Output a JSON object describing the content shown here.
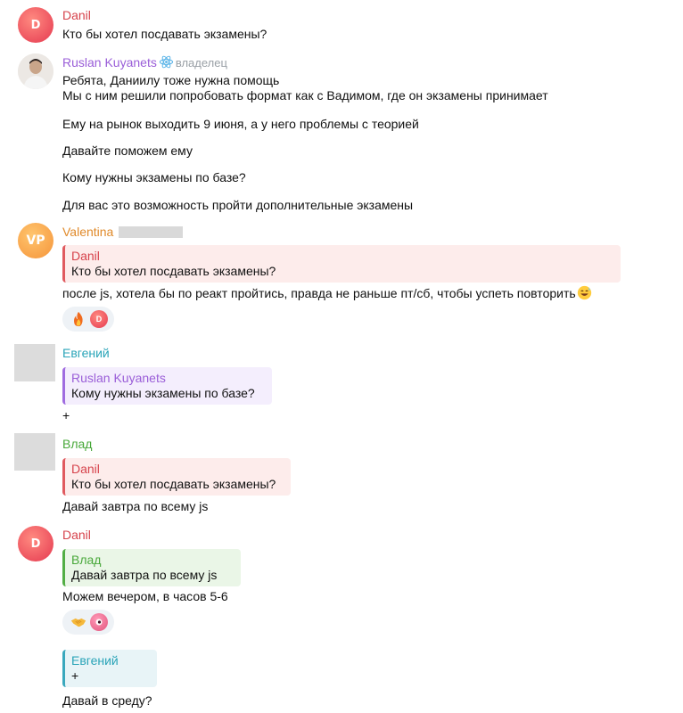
{
  "messages": {
    "m1": {
      "avatar": "D",
      "author": "Danil",
      "text": "Кто бы хотел посдавать экзамены?"
    },
    "m2": {
      "author": "Ruslan Kuyanets",
      "role": "владелец",
      "lines": [
        "Ребята, Даниилу тоже нужна помощь",
        "Мы с ним решили попробовать формат как с Вадимом, где он экзамены принимает",
        "Ему на рынок выходить 9 июня, а у него проблемы с теорией",
        "Давайте поможем ему",
        "Кому нужны экзамены по базе?",
        "Для вас это возможность пройти дополнительные экзамены"
      ]
    },
    "m3": {
      "avatar": "VP",
      "author": "Valentina",
      "quote_author": "Danil",
      "quote_text": "Кто бы хотел посдавать экзамены?",
      "text": "после js, хотела бы по реакт пройтись, правда не раньше пт/сб, чтобы успеть повторить",
      "reaction_avatar": "D"
    },
    "m4": {
      "author": "Евгений",
      "quote_author": "Ruslan Kuyanets",
      "quote_text": "Кому нужны экзамены по базе?",
      "text": "+"
    },
    "m5": {
      "author": "Влад",
      "quote_author": "Danil",
      "quote_text": "Кто бы хотел посдавать экзамены?",
      "text": "Давай завтра по всему js"
    },
    "m6": {
      "avatar": "D",
      "author": "Danil",
      "quote_author": "Влад",
      "quote_text": "Давай завтра по всему js",
      "text": "Можем вечером, в часов 5-6"
    },
    "m7": {
      "quote_author": "Евгений",
      "quote_text": "+",
      "text": "Давай в среду?"
    }
  },
  "icons": {
    "react_badge": "react-atom-icon",
    "fire": "fire-emoji-icon",
    "handshake": "handshake-emoji-icon",
    "sweat_smile": "sweat-smile-emoji-icon"
  }
}
